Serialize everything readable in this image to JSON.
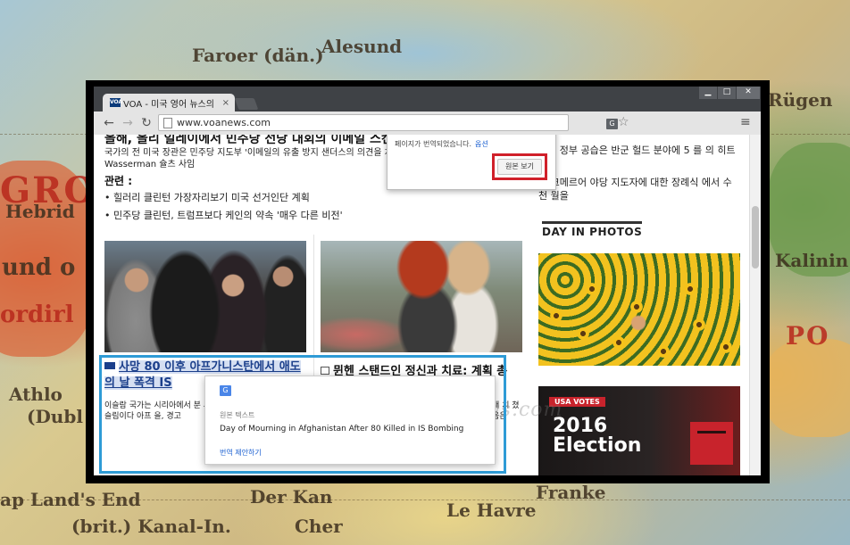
{
  "background": {
    "map_labels": [
      "Faroer (dän.)",
      "Alesund",
      "GRO",
      "Hebrid",
      "und o",
      "ordirl",
      "Athlo",
      "(Dubl",
      "ap Land's End",
      "(brit.) Kanal-In.",
      "Der Kan",
      "Cher",
      "Le Havre",
      "Franke",
      "Kalinin",
      "PO",
      "Rügen"
    ],
    "accent_map_red": "#b8281c"
  },
  "browser": {
    "tab_title": "VOA - 미국 영어 뉴스의",
    "tab_favicon": "VOA",
    "tab_close": "×",
    "window_controls": [
      "▁",
      "□",
      "✕"
    ],
    "url": "www.voanews.com",
    "nav": {
      "back": "←",
      "forward": "→",
      "reload": "↻"
    },
    "translate_icon": "G",
    "star_icon": "☆",
    "menu_icon": "≡"
  },
  "page": {
    "top_headline_cut": "올해, 올리 일레이에서 민주당 전당 대회의 이메일 스캔",
    "top_article_desc": "국가의 전 미국 장관은 민주당 지도부 '이메일의 유출 방지 샌더스의 의견을 차 Wasserman 슐츠 사임",
    "related_heading": "관련 :",
    "related_links": [
      "• 힐러리 클린턴 가장자리보기 미국 선거인단 계획",
      "• 민주당 클린턴, 트럼프보다 케인의 약속 '매우 다른 비전'"
    ],
    "story1": {
      "title": "사망 80 이후 아프가니스탄에서 애도의 날 폭격 IS",
      "desc": "이슬람 국가는 시리아에서 분 시아파 무슬림이다 아프 을, 경고"
    },
    "story2": {
      "title": "뮌헨 스탠드인 정신과 치료: 계획 총",
      "desc": "래 치 쳤음은"
    },
    "right_links": [
      "리아 정부 공습은 반군 헐드 분야에 5 를 의 히트",
      "해 크메르어 야당 지도자에 대한 장례식 에서 수천 월을"
    ],
    "section_heading": "DAY IN PHOTOS",
    "election": {
      "badge": "USA VOTES",
      "year": "2016",
      "word": "Election"
    },
    "watermark": "www.voanews.com"
  },
  "translated_popup": {
    "message": "페이지가 번역되었습니다.",
    "options_link": "옵션",
    "show_original_button": "원본 보기"
  },
  "source_popup": {
    "icon": "G",
    "label": "원본 텍스트",
    "original_text": "Day of Mourning in Afghanistan After 80 Killed in IS Bombing",
    "suggest_link": "번역 제안하기"
  }
}
